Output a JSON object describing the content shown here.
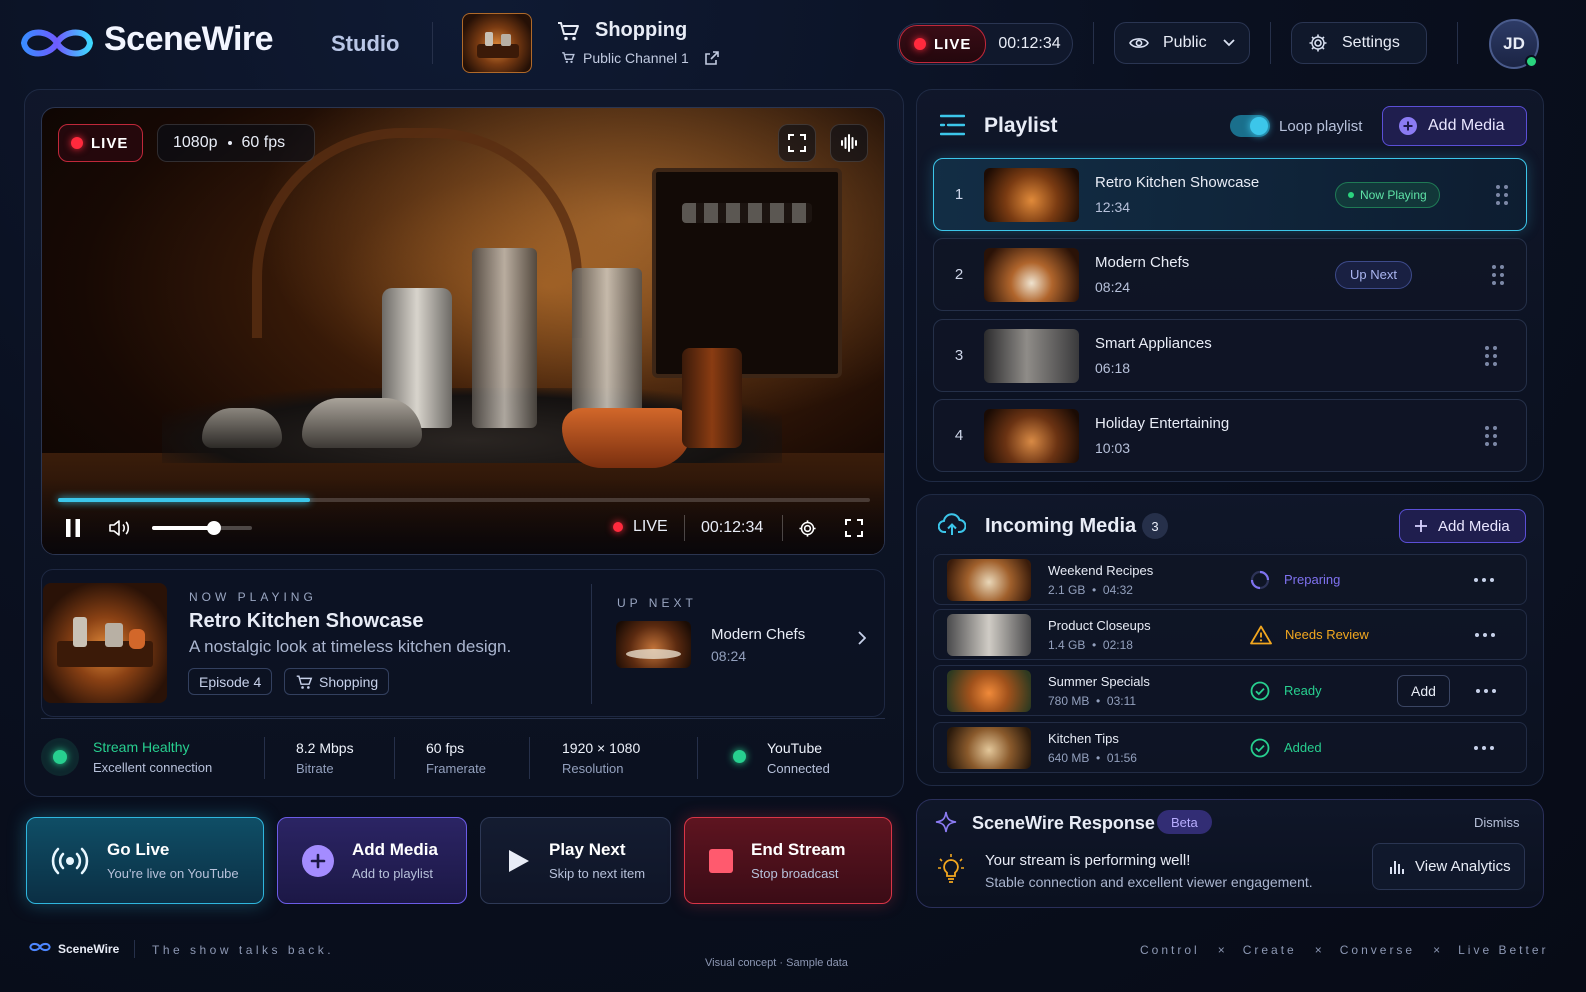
{
  "header": {
    "brand": "SceneWire",
    "section": "Studio",
    "channel_category": "Shopping",
    "channel_name": "Public Channel 1",
    "live_label": "LIVE",
    "live_timer": "00:12:34",
    "visibility": "Public",
    "settings_label": "Settings",
    "avatar_initials": "JD"
  },
  "player": {
    "live_label": "LIVE",
    "quality": "1080p",
    "fps": "60 fps",
    "progress_fraction": 0.31,
    "volume_fraction": 0.62,
    "controls_live_label": "LIVE",
    "timecode": "00:12:34"
  },
  "now_playing": {
    "caption": "NOW PLAYING",
    "title": "Retro Kitchen Showcase",
    "description": "A nostalgic look at timeless kitchen design.",
    "episode_tag": "Episode 4",
    "category_tag": "Shopping"
  },
  "up_next": {
    "caption": "UP NEXT",
    "title": "Modern Chefs",
    "duration": "08:24"
  },
  "stats": {
    "health_title": "Stream Healthy",
    "health_sub": "Excellent connection",
    "bitrate_value": "8.2 Mbps",
    "bitrate_label": "Bitrate",
    "framerate_value": "60 fps",
    "framerate_label": "Framerate",
    "resolution_value": "1920 × 1080",
    "resolution_label": "Resolution",
    "platform_value": "YouTube",
    "platform_label": "Connected"
  },
  "actions": {
    "go_live_title": "Go Live",
    "go_live_sub": "You're live on YouTube",
    "add_media_title": "Add Media",
    "add_media_sub": "Add to playlist",
    "play_next_title": "Play Next",
    "play_next_sub": "Skip to next item",
    "end_stream_title": "End Stream",
    "end_stream_sub": "Stop broadcast"
  },
  "playlist": {
    "title": "Playlist",
    "loop_label": "Loop playlist",
    "loop_on": true,
    "add_label": "Add Media",
    "items": [
      {
        "num": "1",
        "title": "Retro Kitchen Showcase",
        "duration": "12:34",
        "badge": "Now Playing"
      },
      {
        "num": "2",
        "title": "Modern Chefs",
        "duration": "08:24",
        "badge": "Up Next"
      },
      {
        "num": "3",
        "title": "Smart Appliances",
        "duration": "06:18",
        "badge": ""
      },
      {
        "num": "4",
        "title": "Holiday Entertaining",
        "duration": "10:03",
        "badge": ""
      }
    ]
  },
  "incoming": {
    "title": "Incoming Media",
    "count": "3",
    "add_label": "Add Media",
    "add_item_label": "Add",
    "items": [
      {
        "title": "Weekend Recipes",
        "meta": "2.1 GB  •  04:32",
        "status": "Preparing",
        "status_color": "#7f72f0"
      },
      {
        "title": "Product Closeups",
        "meta": "1.4 GB  •  02:18",
        "status": "Needs Review",
        "status_color": "#f2a71f"
      },
      {
        "title": "Summer Specials",
        "meta": "780 MB  •  03:11",
        "status": "Ready",
        "status_color": "#27cf8f"
      },
      {
        "title": "Kitchen Tips",
        "meta": "640 MB  •  01:56",
        "status": "Added",
        "status_color": "#27cf8f"
      }
    ]
  },
  "response": {
    "title": "SceneWire Response",
    "beta": "Beta",
    "dismiss": "Dismiss",
    "headline": "Your stream is performing well!",
    "detail": "Stable connection and excellent viewer engagement.",
    "analytics_label": "View Analytics"
  },
  "footer": {
    "brand": "SceneWire",
    "tagline": "The show talks back.",
    "center_note": "Visual concept · Sample data",
    "right_1": "Control",
    "right_2": "Create",
    "right_3": "Converse",
    "right_4": "Live Better",
    "separator": "×"
  },
  "colors": {
    "accent_cyan": "#3cc6ea",
    "accent_purple": "#6b5ce7",
    "live_red": "#ff2a3d",
    "ok_green": "#27cf8f"
  }
}
